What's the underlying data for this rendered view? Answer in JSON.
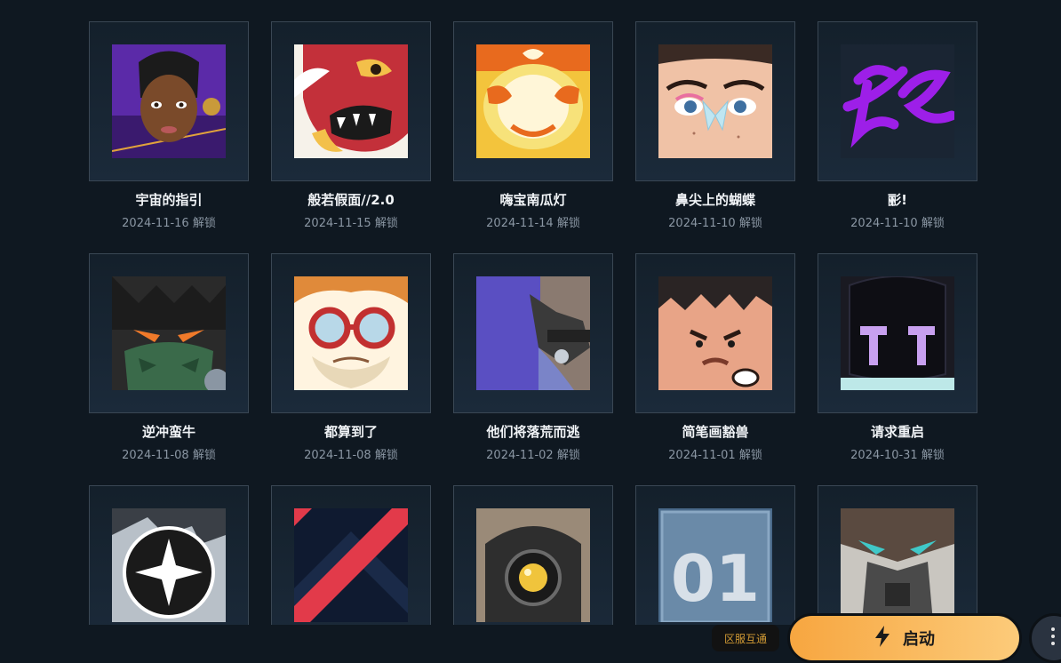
{
  "cards": [
    {
      "name": "宇宙的指引",
      "date": "2024-11-16 解锁"
    },
    {
      "name": "般若假面//2.0",
      "date": "2024-11-15 解锁"
    },
    {
      "name": "嗨宝南瓜灯",
      "date": "2024-11-14 解锁"
    },
    {
      "name": "鼻尖上的蝴蝶",
      "date": "2024-11-10 解锁"
    },
    {
      "name": "彨!",
      "date": "2024-11-10 解锁"
    },
    {
      "name": "逆冲蛮牛",
      "date": "2024-11-08 解锁"
    },
    {
      "name": "都算到了",
      "date": "2024-11-08 解锁"
    },
    {
      "name": "他们将落荒而逃",
      "date": "2024-11-02 解锁"
    },
    {
      "name": "简笔画豁兽",
      "date": "2024-11-01 解锁"
    },
    {
      "name": "请求重启",
      "date": "2024-10-31 解锁"
    },
    {
      "name": "",
      "date": ""
    },
    {
      "name": "",
      "date": ""
    },
    {
      "name": "",
      "date": ""
    },
    {
      "name": "",
      "date": ""
    },
    {
      "name": "",
      "date": ""
    }
  ],
  "card_art_text": {
    "tile_14": "01"
  },
  "footer": {
    "region_badge": "区服互通",
    "launch_label": "启动"
  },
  "colors": {
    "background": "#0f1821",
    "launch_gradient_start": "#f7a640",
    "launch_gradient_end": "#fccb7a",
    "region_text": "#d19a34"
  }
}
